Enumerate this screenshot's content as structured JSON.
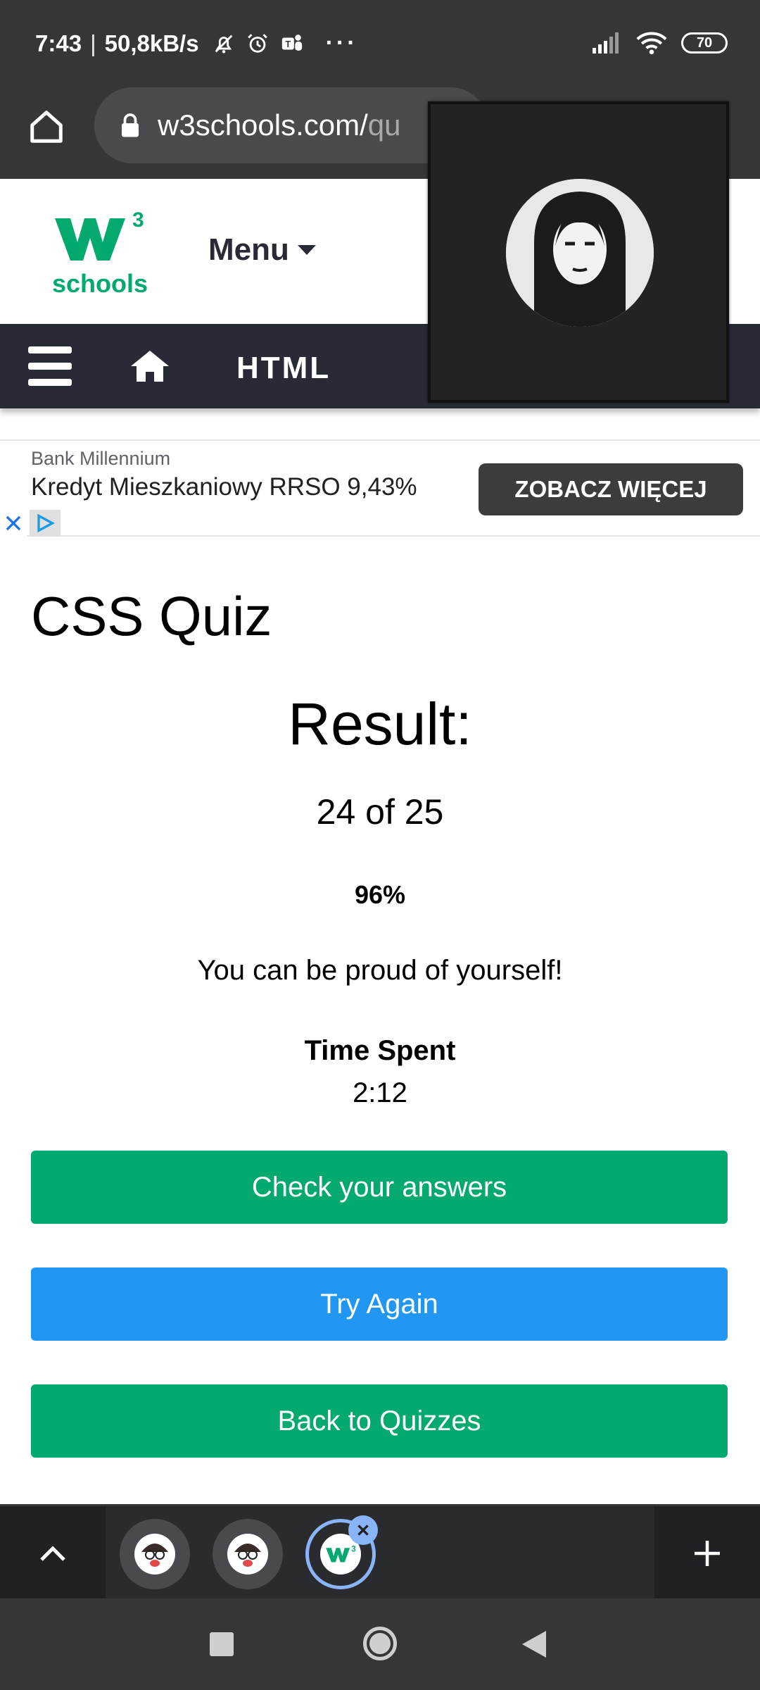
{
  "status_bar": {
    "time": "7:43",
    "separator": "|",
    "speed": "50,8kB/s",
    "more": "···",
    "battery": "70",
    "icons": [
      "muted-bell-icon",
      "alarm-icon",
      "teams-icon",
      "signal-icon",
      "wifi-icon",
      "battery-icon"
    ]
  },
  "browser": {
    "url_host": "w3schools.com/",
    "url_rest": "qu"
  },
  "header": {
    "logo_text": "schools",
    "menu_label": "Menu"
  },
  "topnav": {
    "section": "HTML"
  },
  "ad": {
    "sponsor": "Bank Millennium",
    "title": "Kredyt Mieszkaniowy RRSO 9,43%",
    "cta": "ZOBACZ WIĘCEJ"
  },
  "quiz": {
    "title": "CSS Quiz",
    "result_heading": "Result:",
    "score": "24 of 25",
    "percent": "96%",
    "message": "You can be proud of yourself!",
    "time_label": "Time Spent",
    "time_value": "2:12"
  },
  "buttons": {
    "check": "Check your answers",
    "try_again": "Try Again",
    "back": "Back to Quizzes"
  },
  "colors": {
    "w3_green": "#04aa6d",
    "try_blue": "#2196f3",
    "nav_dark": "#282a35",
    "chrome_dark": "#35363a"
  }
}
